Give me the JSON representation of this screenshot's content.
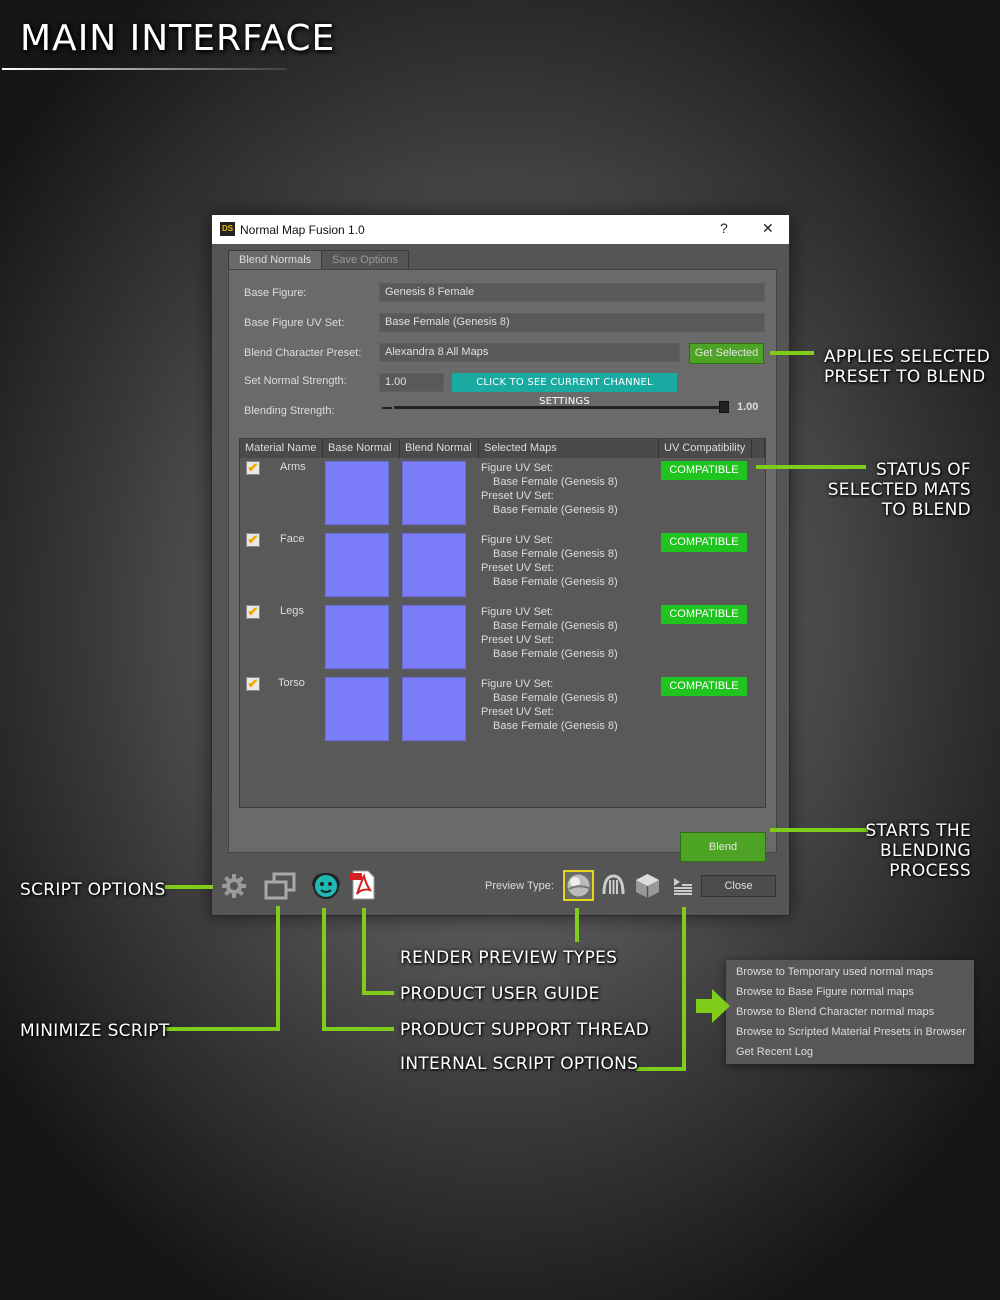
{
  "headline": "MAIN INTERFACE",
  "dialog": {
    "logo": "DS",
    "title": "Normal Map Fusion 1.0",
    "help_label": "?",
    "close_label": "✕",
    "tabs": [
      {
        "label": "Blend Normals",
        "active": true
      },
      {
        "label": "Save Options",
        "active": false
      }
    ],
    "fields": {
      "base_figure": {
        "label": "Base Figure:",
        "value": "Genesis 8 Female"
      },
      "base_uv": {
        "label": "Base Figure UV Set:",
        "value": "Base Female (Genesis 8)"
      },
      "preset": {
        "label": "Blend Character Preset:",
        "value": "Alexandra 8 All Maps",
        "button": "Get Selected"
      },
      "normal_strength": {
        "label": "Set Normal Strength:",
        "value": "1.00",
        "link": "Click to see current channel settings"
      },
      "blending_strength": {
        "label": "Blending Strength:",
        "value": "1.00",
        "level": 1.0
      }
    },
    "table": {
      "headers": [
        "Material Name",
        "Base Normal",
        "Blend Normal",
        "Selected Maps",
        "UV Compatibility"
      ],
      "rows": [
        {
          "checked": true,
          "name": "Arms",
          "figure_uv_label": "Figure UV Set:",
          "figure_uv": "Base Female (Genesis 8)",
          "preset_uv_label": "Preset UV Set:",
          "preset_uv": "Base Female (Genesis 8)",
          "status": "COMPATIBLE"
        },
        {
          "checked": true,
          "name": "Face",
          "figure_uv_label": "Figure UV Set:",
          "figure_uv": "Base Female (Genesis 8)",
          "preset_uv_label": "Preset UV Set:",
          "preset_uv": "Base Female (Genesis 8)",
          "status": "COMPATIBLE"
        },
        {
          "checked": true,
          "name": "Legs",
          "figure_uv_label": "Figure UV Set:",
          "figure_uv": "Base Female (Genesis 8)",
          "preset_uv_label": "Preset UV Set:",
          "preset_uv": "Base Female (Genesis 8)",
          "status": "COMPATIBLE"
        },
        {
          "checked": true,
          "name": "Torso",
          "figure_uv_label": "Figure UV Set:",
          "figure_uv": "Base Female (Genesis 8)",
          "preset_uv_label": "Preset UV Set:",
          "preset_uv": "Base Female (Genesis 8)",
          "status": "COMPATIBLE"
        }
      ]
    },
    "blend_button": "Blend",
    "preview_type_label": "Preview Type:",
    "close_button": "Close"
  },
  "callouts": {
    "applies": [
      "APPLIES SELECTED",
      "PRESET TO BLEND"
    ],
    "status": [
      "STATUS OF",
      "SELECTED MATS",
      "TO BLEND"
    ],
    "starts": [
      "STARTS THE",
      "BLENDING",
      "PROCESS"
    ],
    "script_options": "SCRIPT OPTIONS",
    "minimize": "MINIMIZE SCRIPT",
    "render_preview": "RENDER PREVIEW TYPES",
    "user_guide": "PRODUCT USER GUIDE",
    "support": "PRODUCT SUPPORT THREAD",
    "internal": "INTERNAL SCRIPT OPTIONS"
  },
  "menu": {
    "items": [
      "Browse to Temporary used normal maps",
      "Browse to Base Figure normal maps",
      "Browse to Blend Character normal maps",
      "Browse to Scripted Material Presets in Browser",
      "Get Recent Log"
    ]
  },
  "colors": {
    "accent_green": "#7fcc1b",
    "compatible": "#1fc41f",
    "teal": "#19aaa2",
    "normal_map": "#7b7cf7"
  },
  "icons": [
    "gear-icon",
    "minimize-icon",
    "support-icon",
    "pdf-icon",
    "sphere-preview-icon",
    "hair-preview-icon",
    "cube-preview-icon",
    "options-menu-icon",
    "arrow-right-icon"
  ]
}
